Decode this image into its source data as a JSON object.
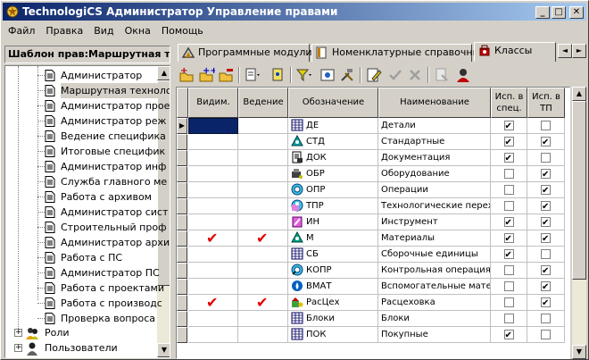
{
  "window": {
    "title": "TechnologiCS Администратор Управление правами",
    "controls": [
      "_",
      "□",
      "✕"
    ]
  },
  "menu": [
    "Файл",
    "Правка",
    "Вид",
    "Окна",
    "Помощь"
  ],
  "left_panel": {
    "header": "Шаблон прав:Маршрутная тех",
    "tree_items": [
      "Администратор",
      "Маршрутная технологи",
      "Администратор прое",
      "Администратор реж",
      "Ведение специфика",
      "Итоговые специфик",
      "Администратор инф",
      "Служба главного ме",
      "Работа с архивом",
      "Администратор сист",
      "Строительный проф",
      "Администратор архи",
      "Работа с ПС",
      "Администратор ПС",
      "Работа с проектами",
      "Работа с производс",
      "Проверка вопроса"
    ],
    "roots": [
      {
        "label": "Роли",
        "icon": "roles-icon"
      },
      {
        "label": "Пользователи",
        "icon": "users-icon"
      }
    ]
  },
  "tabs": [
    {
      "label": "Программные модули",
      "icon": "modules-icon"
    },
    {
      "label": "Номенклатурные справочники",
      "icon": "catalog-icon"
    },
    {
      "label": "Классы",
      "icon": "classes-icon"
    }
  ],
  "grid": {
    "headers": {
      "visible": "Видим.",
      "maintain": "Ведение",
      "code": "Обозначение",
      "name": "Наименование",
      "spec_line1": "Исп. в",
      "spec_line2": "спец.",
      "tp_line1": "Исп. в",
      "tp_line2": "ТП"
    },
    "rows": [
      {
        "visible": false,
        "maintain": false,
        "code": "ДЕ",
        "name": "Детали",
        "icon": "table-icon",
        "spec": true,
        "tp": false
      },
      {
        "visible": false,
        "maintain": false,
        "code": "СТД",
        "name": "Стандартные",
        "icon": "standard-icon",
        "spec": true,
        "tp": true
      },
      {
        "visible": false,
        "maintain": false,
        "code": "ДОК",
        "name": "Документация",
        "icon": "document-icon",
        "spec": true,
        "tp": false
      },
      {
        "visible": false,
        "maintain": false,
        "code": "ОБР",
        "name": "Оборудование",
        "icon": "equipment-icon",
        "spec": false,
        "tp": true
      },
      {
        "visible": false,
        "maintain": false,
        "code": "ОПР",
        "name": "Операции",
        "icon": "operation-icon",
        "spec": false,
        "tp": true
      },
      {
        "visible": false,
        "maintain": false,
        "code": "ТПР",
        "name": "Технологические перех",
        "icon": "transition-icon",
        "spec": false,
        "tp": true
      },
      {
        "visible": false,
        "maintain": false,
        "code": "ИН",
        "name": "Инструмент",
        "icon": "tool-icon",
        "spec": true,
        "tp": true
      },
      {
        "visible": true,
        "maintain": true,
        "code": "М",
        "name": "Материалы",
        "icon": "material-icon",
        "spec": true,
        "tp": true
      },
      {
        "visible": false,
        "maintain": false,
        "code": "СБ",
        "name": "Сборочные единицы",
        "icon": "table-icon",
        "spec": true,
        "tp": false
      },
      {
        "visible": false,
        "maintain": false,
        "code": "КОПР",
        "name": "Контрольная операция",
        "icon": "control-icon",
        "spec": false,
        "tp": true
      },
      {
        "visible": false,
        "maintain": false,
        "code": "ВМАТ",
        "name": "Вспомогательные мате",
        "icon": "drop-icon",
        "spec": false,
        "tp": true
      },
      {
        "visible": true,
        "maintain": true,
        "code": "РасЦех",
        "name": "Расцеховка",
        "icon": "workshop-icon",
        "spec": false,
        "tp": true
      },
      {
        "visible": false,
        "maintain": false,
        "code": "Блоки",
        "name": "Блоки",
        "icon": "table-icon",
        "spec": false,
        "tp": false
      },
      {
        "visible": false,
        "maintain": false,
        "code": "ПОК",
        "name": "Покупные",
        "icon": "table-icon",
        "spec": true,
        "tp": false
      }
    ]
  },
  "toolbar_icons": [
    "add-class-icon",
    "add-subclass-icon",
    "delete-class-icon",
    "document-menu-icon",
    "properties-icon",
    "filter-icon",
    "view-icon",
    "tools-icon",
    "edit-icon",
    "apply-icon",
    "cancel-icon",
    "export-icon",
    "user-icon"
  ]
}
